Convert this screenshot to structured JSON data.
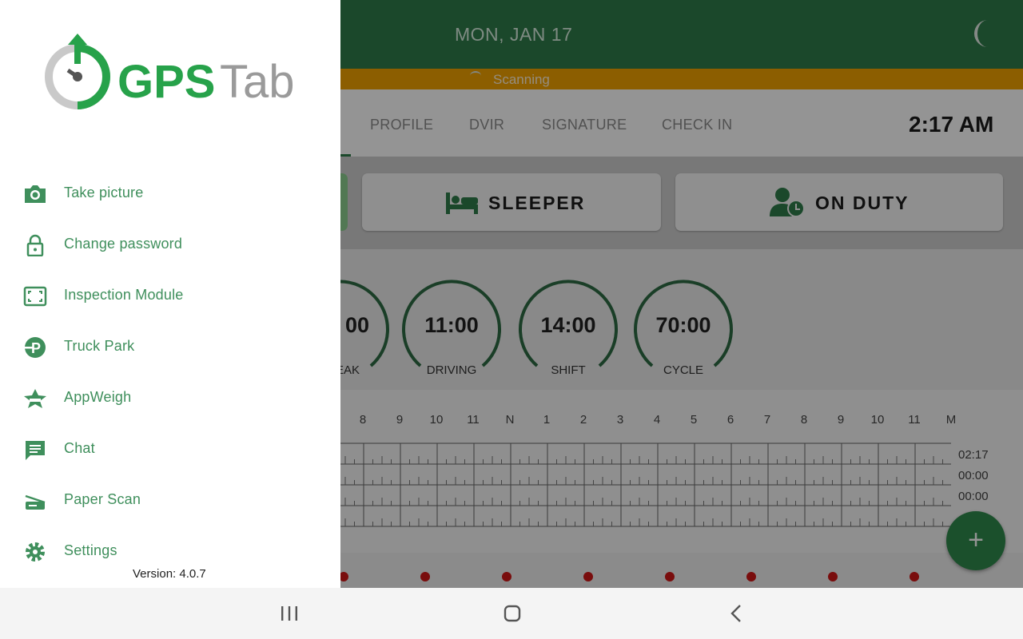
{
  "header": {
    "date": "MON, JAN 17",
    "night_mode_icon": "moon-icon"
  },
  "scan": {
    "status": "Scanning"
  },
  "tabs": [
    {
      "label": "PROFILE"
    },
    {
      "label": "DVIR"
    },
    {
      "label": "SIGNATURE"
    },
    {
      "label": "CHECK IN"
    }
  ],
  "clock": "2:17 AM",
  "duty_status": {
    "sleeper": {
      "label": "SLEEPER",
      "icon": "bed-icon"
    },
    "on_duty": {
      "label": "ON DUTY",
      "icon": "person-clock-icon"
    }
  },
  "gauges": [
    {
      "value": "00",
      "label": "EAK"
    },
    {
      "value": "11:00",
      "label": "DRIVING"
    },
    {
      "value": "14:00",
      "label": "SHIFT"
    },
    {
      "value": "70:00",
      "label": "CYCLE"
    }
  ],
  "log": {
    "hours": [
      "8",
      "9",
      "10",
      "11",
      "N",
      "1",
      "2",
      "3",
      "4",
      "5",
      "6",
      "7",
      "8",
      "9",
      "10",
      "11",
      "M"
    ],
    "totals": [
      "02:17",
      "00:00",
      "00:00"
    ]
  },
  "fab": {
    "label": "+",
    "icon": "plus-icon"
  },
  "drawer": {
    "logo": {
      "primary": "GPS",
      "secondary": "Tab"
    },
    "items": [
      {
        "label": "Take picture",
        "icon": "camera-icon"
      },
      {
        "label": "Change password",
        "icon": "lock-icon"
      },
      {
        "label": "Inspection Module",
        "icon": "inspection-frame-icon"
      },
      {
        "label": "Truck Park",
        "icon": "truck-park-icon"
      },
      {
        "label": "AppWeigh",
        "icon": "appweigh-icon"
      },
      {
        "label": "Chat",
        "icon": "chat-icon"
      },
      {
        "label": "Paper Scan",
        "icon": "scanner-icon"
      },
      {
        "label": "Settings",
        "icon": "gear-icon"
      }
    ],
    "version": "Version: 4.0.7"
  },
  "navbar": {
    "recents": "recents-icon",
    "home": "home-icon",
    "back": "back-icon"
  },
  "colors": {
    "primary": "#2f7d4a",
    "accent": "#f2a300",
    "drawer_text": "#3f8f5c"
  }
}
